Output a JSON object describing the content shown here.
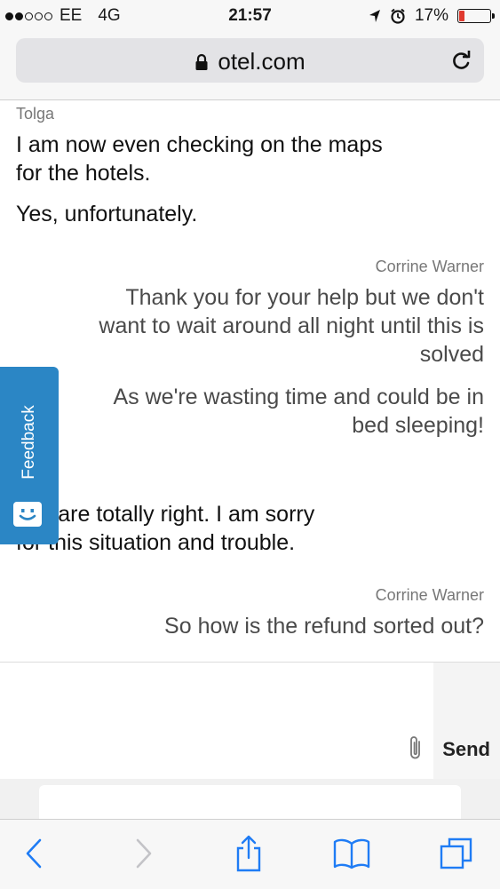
{
  "status_bar": {
    "carrier": "EE",
    "network": "4G",
    "time": "21:57",
    "battery_percent": "17%",
    "battery_level": 0.17,
    "signal_bars_filled": 2,
    "signal_bars_total": 5
  },
  "browser": {
    "url": "otel.com",
    "icons": {
      "lock": "lock-icon",
      "reload": "reload-icon"
    }
  },
  "chat": {
    "messages": [
      {
        "sender": "Tolga",
        "align": "left",
        "lines": [
          "I am now even checking on the maps",
          "for the hotels."
        ]
      },
      {
        "sender": "",
        "align": "left",
        "lines": [
          "Yes, unfortunately."
        ]
      },
      {
        "sender": "Corrine Warner",
        "align": "right",
        "lines": [
          "Thank you for your help but we don't",
          "want to wait around all night until this is",
          "solved"
        ]
      },
      {
        "sender": "",
        "align": "right",
        "lines": [
          "As we're wasting time and could be in",
          "bed sleeping!"
        ]
      },
      {
        "sender": "",
        "align": "left",
        "lines": [
          "you are totally right. I am sorry",
          "for this situation and trouble."
        ]
      },
      {
        "sender": "Corrine Warner",
        "align": "right",
        "lines": [
          "So how is the refund sorted out?"
        ]
      }
    ]
  },
  "feedback_tab": {
    "label": "Feedback",
    "icon": "smiley-icon"
  },
  "composer": {
    "send_label": "Send",
    "attach_icon": "paperclip-icon"
  },
  "toolbar": {
    "icons": [
      "back-icon",
      "forward-icon",
      "share-icon",
      "bookmarks-icon",
      "tabs-icon"
    ]
  },
  "colors": {
    "feedback_blue": "#2b86c5",
    "battery_low": "#e03a2f",
    "ios_blue": "#1f7cf5"
  }
}
